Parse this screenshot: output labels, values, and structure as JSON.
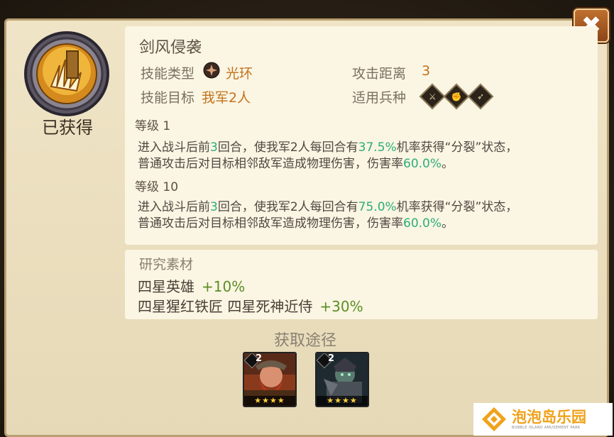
{
  "dialog": {
    "close_label": "✖",
    "status_label": "已获得"
  },
  "skill": {
    "name": "剑风侵袭",
    "type_label": "技能类型",
    "type_value": "光环",
    "target_label": "技能目标",
    "target_value": "我军2人",
    "range_label": "攻击距离",
    "range_value": "3",
    "troop_label": "适用兵种",
    "troop_icons": [
      "sword-troop-icon",
      "fist-troop-icon",
      "bow-troop-icon"
    ]
  },
  "levels": [
    {
      "label": "等级 1",
      "line1": [
        {
          "text": "进入战斗后前",
          "hl": false
        },
        {
          "text": "3",
          "hl": true
        },
        {
          "text": "回合，使我军2人每回合有",
          "hl": false
        },
        {
          "text": "37.5%",
          "hl": true
        },
        {
          "text": "机率获得“分裂”状态，",
          "hl": false
        }
      ],
      "line2": [
        {
          "text": "普通攻击后对目标相邻敌军造成物理伤害，伤害率",
          "hl": false
        },
        {
          "text": "60.0%",
          "hl": true
        },
        {
          "text": "。",
          "hl": false
        }
      ]
    },
    {
      "label": "等级 10",
      "line1": [
        {
          "text": "进入战斗后前",
          "hl": false
        },
        {
          "text": "3",
          "hl": true
        },
        {
          "text": "回合，使我军2人每回合有",
          "hl": false
        },
        {
          "text": "75.0%",
          "hl": true
        },
        {
          "text": "机率获得“分裂”状态，",
          "hl": false
        }
      ],
      "line2": [
        {
          "text": "普通攻击后对目标相邻敌军造成物理伤害，伤害率",
          "hl": false
        },
        {
          "text": "60.0%",
          "hl": true
        },
        {
          "text": "。",
          "hl": false
        }
      ]
    }
  ],
  "research": {
    "title": "研究素材",
    "lines": [
      {
        "name": "四星英雄",
        "bonus": "+10%"
      },
      {
        "name": "四星猩红铁匠 四星死神近侍",
        "bonus": "+30%"
      }
    ]
  },
  "obtain": {
    "title": "获取途径",
    "heroes": [
      {
        "level": "2",
        "stars": "★★★★",
        "name": "red-bearded-dwarf-portrait"
      },
      {
        "level": "2",
        "stars": "★★★★",
        "name": "undead-knight-portrait"
      }
    ]
  },
  "watermark": {
    "name": "泡泡岛乐园",
    "sub": "BUBBLE ISLAND AMUSEMENT PARK"
  },
  "colors": {
    "highlight": "#2cae79",
    "orange": "#c0731c",
    "bonus": "#5a8f24",
    "panel": "#efe4c6"
  }
}
